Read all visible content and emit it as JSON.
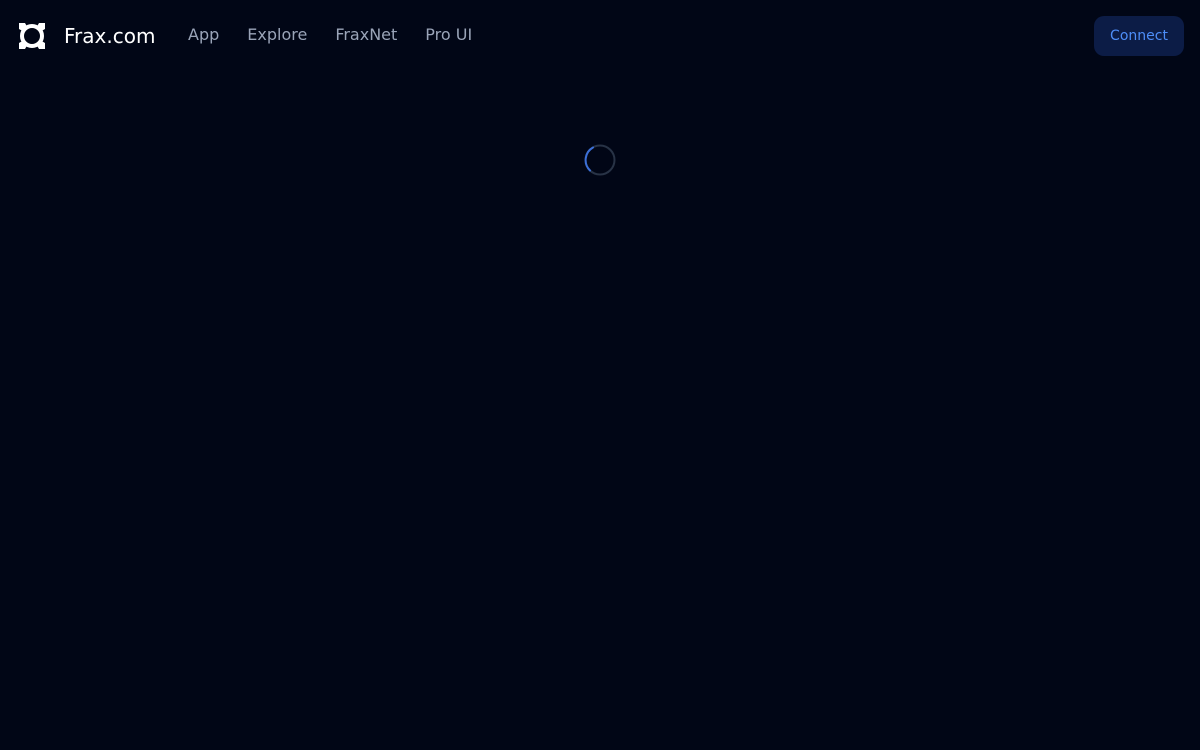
{
  "header": {
    "brand_name": "Frax.com",
    "brand_icon": "frax-logo-icon",
    "nav_items": [
      {
        "label": "App"
      },
      {
        "label": "Explore"
      },
      {
        "label": "FraxNet"
      },
      {
        "label": "Pro UI"
      }
    ],
    "connect_label": "Connect"
  },
  "main": {
    "loading_icon": "loading-spinner-icon"
  },
  "colors": {
    "background": "#010616",
    "brand_text": "#ffffff",
    "nav_text": "#9aa4b8",
    "connect_bg": "#0c1c46",
    "connect_text": "#4d8df8",
    "spinner_track": "#283346",
    "spinner_arc": "#3b6fd8"
  }
}
